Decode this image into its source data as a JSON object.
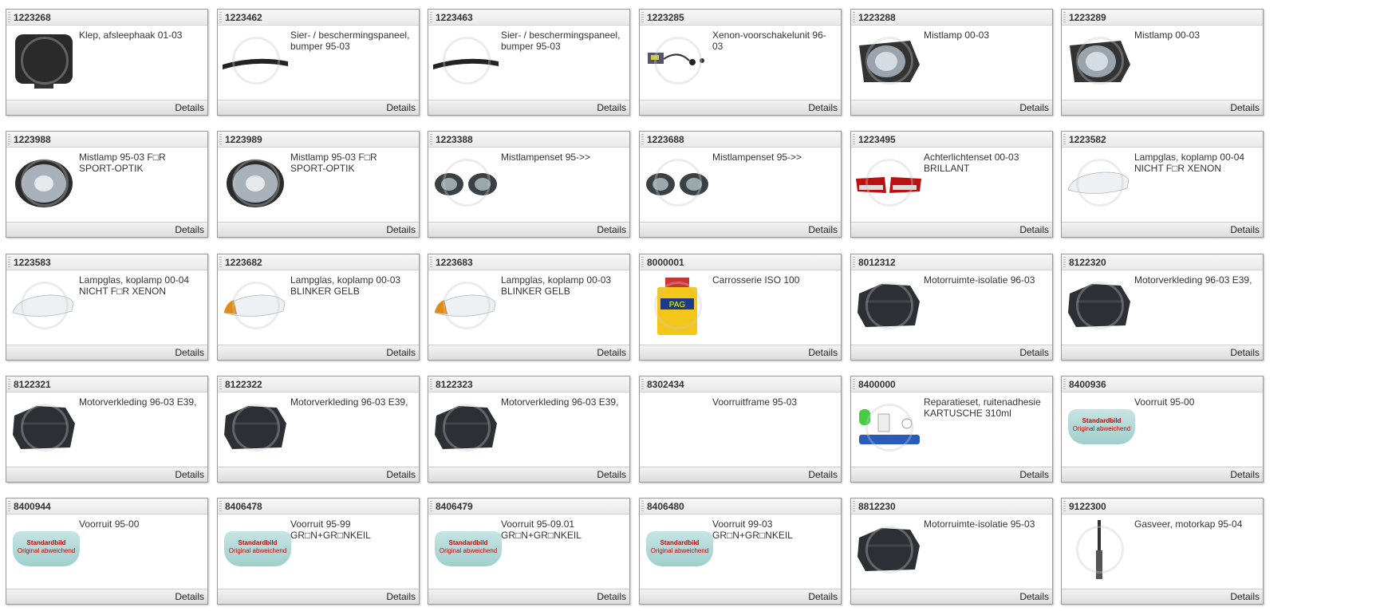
{
  "details_label": "Details",
  "items": [
    {
      "num": "1223268",
      "desc": "Klep, afsleephaak 01-03",
      "img": "cover"
    },
    {
      "num": "1223462",
      "desc": "Sier- / beschermingspaneel, bumper 95-03",
      "img": "strip"
    },
    {
      "num": "1223463",
      "desc": "Sier- / beschermingspaneel, bumper 95-03",
      "img": "strip"
    },
    {
      "num": "1223285",
      "desc": "Xenon-voorschakelunit 96-03",
      "img": "xenon"
    },
    {
      "num": "1223288",
      "desc": "Mistlamp 00-03",
      "img": "foglamp"
    },
    {
      "num": "1223289",
      "desc": "Mistlamp 00-03",
      "img": "foglamp"
    },
    {
      "num": "1223988",
      "desc": "Mistlamp 95-03 F□R SPORT-OPTIK",
      "img": "round"
    },
    {
      "num": "1223989",
      "desc": "Mistlamp 95-03 F□R SPORT-OPTIK",
      "img": "round"
    },
    {
      "num": "1223388",
      "desc": "Mistlampenset 95->>",
      "img": "pair"
    },
    {
      "num": "1223688",
      "desc": "Mistlampenset 95->>",
      "img": "pair"
    },
    {
      "num": "1223495",
      "desc": "Achterlichtenset 00-03 BRILLANT",
      "img": "taillights"
    },
    {
      "num": "1223582",
      "desc": "Lampglas, koplamp 00-04 NICHT F□R XENON",
      "img": "glass"
    },
    {
      "num": "1223583",
      "desc": "Lampglas, koplamp 00-04 NICHT F□R XENON",
      "img": "glass"
    },
    {
      "num": "1223682",
      "desc": "Lampglas, koplamp 00-03 BLINKER GELB",
      "img": "glassamber"
    },
    {
      "num": "1223683",
      "desc": "Lampglas, koplamp 00-03 BLINKER GELB",
      "img": "glassamber"
    },
    {
      "num": "8000001",
      "desc": "Carrosserie ISO 100",
      "img": "can"
    },
    {
      "num": "8012312",
      "desc": "Motorruimte-isolatie 96-03",
      "img": "shield"
    },
    {
      "num": "8122320",
      "desc": "Motorverkleding 96-03 E39,",
      "img": "shield"
    },
    {
      "num": "8122321",
      "desc": "Motorverkleding 96-03 E39,",
      "img": "shield"
    },
    {
      "num": "8122322",
      "desc": "Motorverkleding 96-03 E39,",
      "img": "shield"
    },
    {
      "num": "8122323",
      "desc": "Motorverkleding 96-03 E39,",
      "img": "shield"
    },
    {
      "num": "8302434",
      "desc": "Voorruitframe 95-03",
      "img": "none"
    },
    {
      "num": "8400000",
      "desc": "Reparatieset, ruitenadhesie KARTUSCHE 310ml",
      "img": "kit"
    },
    {
      "num": "8400936",
      "desc": "Voorruit 95-00",
      "img": "windshield"
    },
    {
      "num": "8400944",
      "desc": "Voorruit 95-00",
      "img": "windshield"
    },
    {
      "num": "8406478",
      "desc": "Voorruit 95-99 GR□N+GR□NKEIL",
      "img": "windshield"
    },
    {
      "num": "8406479",
      "desc": "Voorruit 95-09.01 GR□N+GR□NKEIL",
      "img": "windshield"
    },
    {
      "num": "8406480",
      "desc": "Voorruit 99-03 GR□N+GR□NKEIL",
      "img": "windshield"
    },
    {
      "num": "8812230",
      "desc": "Motorruimte-isolatie 95-03",
      "img": "shield"
    },
    {
      "num": "9122300",
      "desc": "Gasveer, motorkap 95-04",
      "img": "strut"
    }
  ],
  "standardbild": {
    "line1": "Standardbild",
    "line2": "Original abweichend"
  }
}
